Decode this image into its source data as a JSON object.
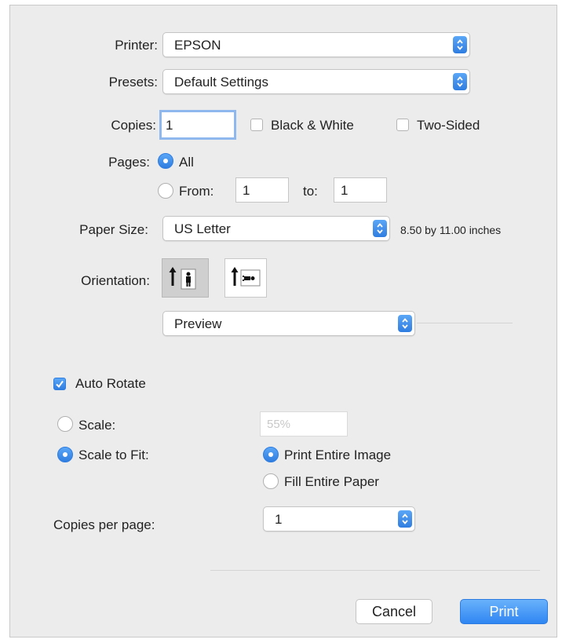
{
  "printer": {
    "label": "Printer:",
    "value": "EPSON"
  },
  "presets": {
    "label": "Presets:",
    "value": "Default Settings"
  },
  "copies": {
    "label": "Copies:",
    "value": "1",
    "black_white_label": "Black & White",
    "two_sided_label": "Two-Sided"
  },
  "pages": {
    "label": "Pages:",
    "all_label": "All",
    "from_label": "From:",
    "from_value": "1",
    "to_label": "to:",
    "to_value": "1",
    "selected": "all"
  },
  "paper": {
    "label": "Paper Size:",
    "value": "US Letter",
    "dimensions": "8.50 by 11.00 inches"
  },
  "orientation": {
    "label": "Orientation:",
    "selected": "portrait"
  },
  "panel": {
    "value": "Preview"
  },
  "auto_rotate": {
    "label": "Auto Rotate",
    "checked": true
  },
  "scale": {
    "label": "Scale:",
    "placeholder": "55%",
    "fit_label": "Scale to Fit:",
    "print_entire_label": "Print Entire Image",
    "fill_entire_label": "Fill Entire Paper"
  },
  "copies_per_page": {
    "label": "Copies per page:",
    "value": "1"
  },
  "buttons": {
    "cancel": "Cancel",
    "print": "Print"
  },
  "colors": {
    "accent": "#3b8ff0",
    "background": "#ececec"
  }
}
